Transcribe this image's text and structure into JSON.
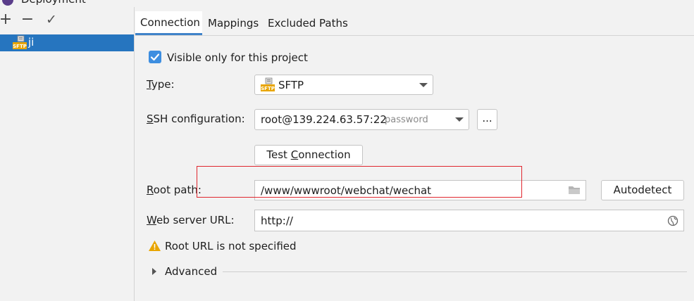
{
  "window": {
    "title": "Deployment"
  },
  "toolbar": {
    "add": "+",
    "remove": "−",
    "apply": "✓"
  },
  "tree": {
    "items": [
      {
        "label": "ji",
        "icon": "sftp-server-icon"
      }
    ]
  },
  "tabs": [
    "Connection",
    "Mappings",
    "Excluded Paths"
  ],
  "form": {
    "visible_only": {
      "checked": true,
      "label": "Visible only for this project"
    },
    "type": {
      "label_mnemonic": "T",
      "label_rest": "ype:",
      "value": "SFTP"
    },
    "ssh": {
      "label_mnemonic": "S",
      "label_rest": "SH configuration:",
      "value": "root@139.224.63.57:22",
      "hint": "password",
      "more_button": "..."
    },
    "test_connection": {
      "label_pre": "Test ",
      "label_mnemonic": "C",
      "label_post": "onnection"
    },
    "root_path": {
      "label_mnemonic": "R",
      "label_rest": "oot path:",
      "value": "/www/wwwroot/webchat/wechat",
      "autodetect_button": "Autodetect"
    },
    "web_server_url": {
      "label_mnemonic": "W",
      "label_rest": "eb server URL:",
      "value": "http://"
    },
    "warning": {
      "text": "Root URL is not specified",
      "icon": "warning-icon"
    },
    "advanced": {
      "label": "Advanced",
      "icon": "chevron-right-icon"
    }
  },
  "colors": {
    "accent": "#3d8ee0",
    "selection": "#2675bf",
    "highlight_box": "#e0262e",
    "warning": "#e8a500"
  }
}
